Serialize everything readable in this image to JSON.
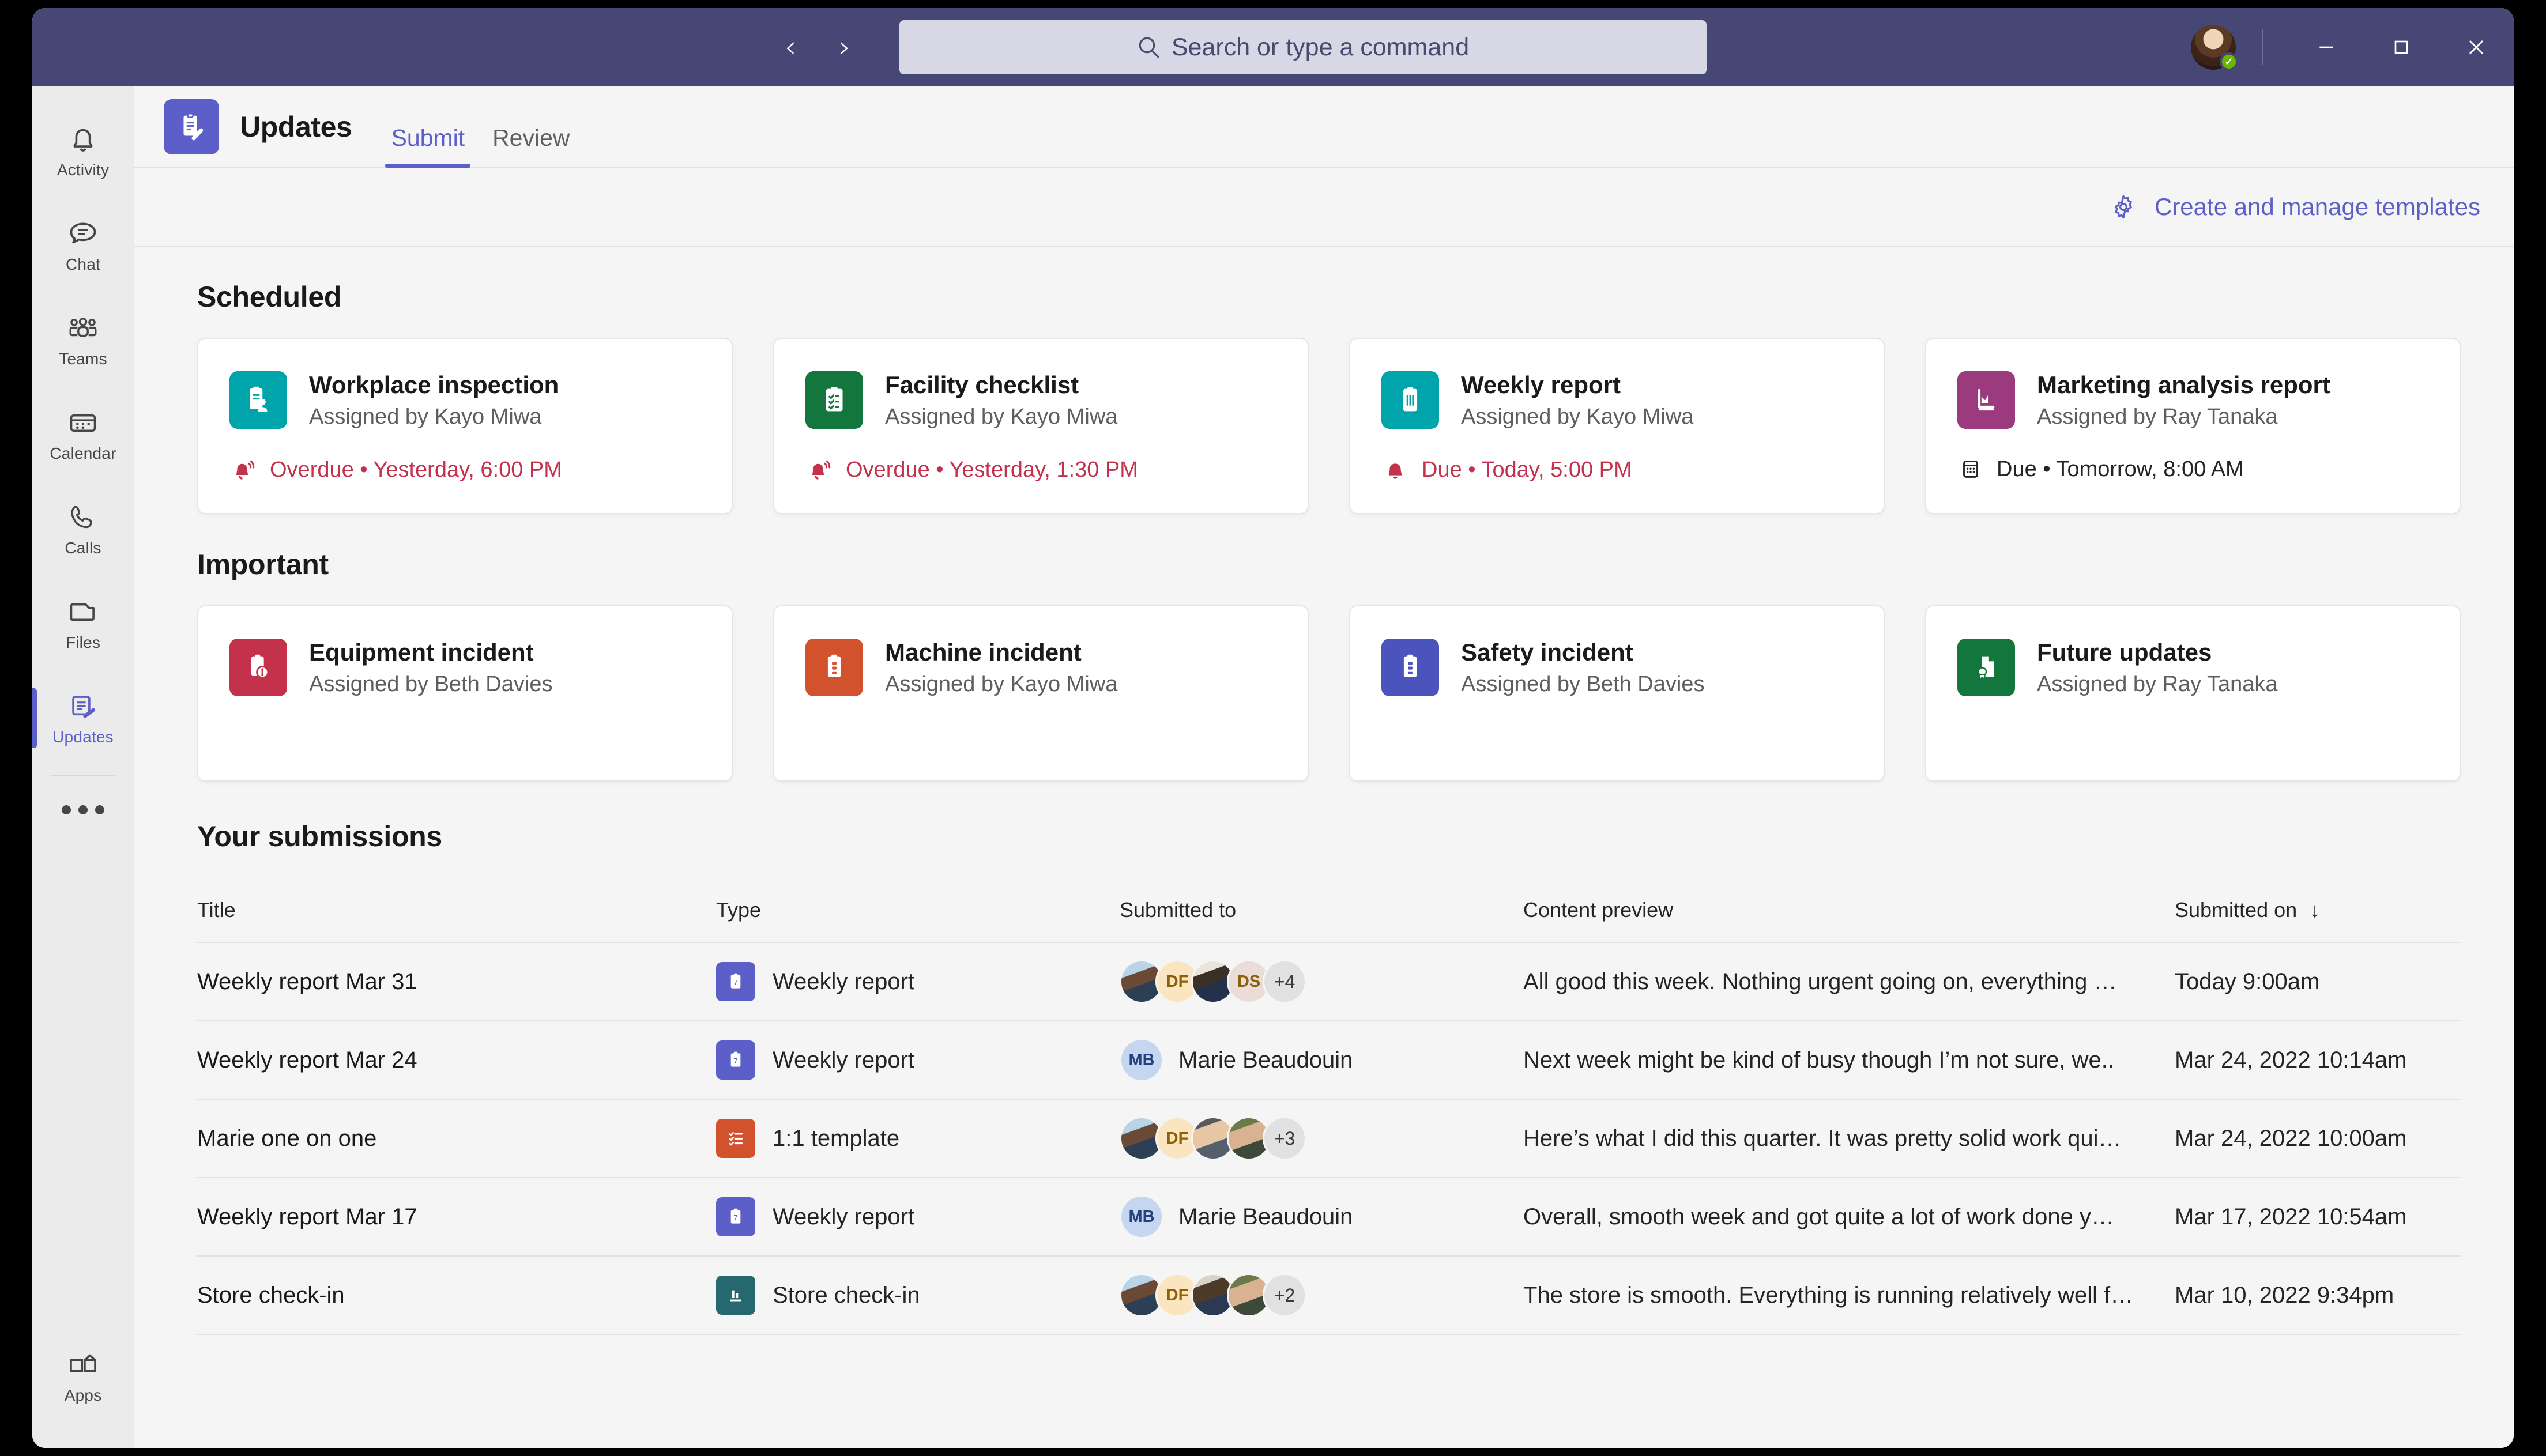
{
  "titlebar": {
    "back_label": "‹",
    "forward_label": "›",
    "search_placeholder": "Search or type a command",
    "minimize_label": "—",
    "maximize_label": "▢",
    "close_label": "✕"
  },
  "rail": {
    "items": [
      {
        "label": "Activity",
        "icon": "bell-icon"
      },
      {
        "label": "Chat",
        "icon": "chat-icon"
      },
      {
        "label": "Teams",
        "icon": "teams-icon"
      },
      {
        "label": "Calendar",
        "icon": "calendar-icon"
      },
      {
        "label": "Calls",
        "icon": "phone-icon"
      },
      {
        "label": "Files",
        "icon": "files-icon"
      },
      {
        "label": "Updates",
        "icon": "clipboard-pen-icon",
        "active": true
      }
    ],
    "more_label": "•••",
    "apps_label": "Apps"
  },
  "header": {
    "app_title": "Updates",
    "app_icon": "clipboard-pen-icon",
    "tabs": [
      {
        "label": "Submit",
        "active": true
      },
      {
        "label": "Review",
        "active": false
      }
    ]
  },
  "toolbar": {
    "templates_label": "Create and manage templates",
    "templates_icon": "gear-icon"
  },
  "sections": [
    {
      "title": "Scheduled",
      "cards": [
        {
          "name": "Workplace inspection",
          "assigned": "Assigned by Kayo Miwa",
          "badge_color": "#00a5ac",
          "badge_icon": "inspection-icon",
          "due_text": "Overdue • Yesterday, 6:00 PM",
          "due_state": "overdue",
          "due_icon": "bell-ring-icon"
        },
        {
          "name": "Facility checklist",
          "assigned": "Assigned by Kayo Miwa",
          "badge_color": "#13773d",
          "badge_icon": "checklist-icon",
          "due_text": "Overdue • Yesterday, 1:30 PM",
          "due_state": "overdue",
          "due_icon": "bell-ring-icon"
        },
        {
          "name": "Weekly report",
          "assigned": "Assigned by Kayo Miwa",
          "badge_color": "#00a5ac",
          "badge_icon": "report-icon",
          "due_text": "Due • Today, 5:00 PM",
          "due_state": "due",
          "due_icon": "bell-icon"
        },
        {
          "name": "Marketing analysis report",
          "assigned": "Assigned by Ray Tanaka",
          "badge_color": "#9b3b7e",
          "badge_icon": "chart-icon",
          "due_text": "Due • Tomorrow, 8:00 AM",
          "due_state": "normal",
          "due_icon": "calendar-icon"
        }
      ]
    },
    {
      "title": "Important",
      "cards": [
        {
          "name": "Equipment incident",
          "assigned": "Assigned by Beth Davies",
          "badge_color": "#c4314b",
          "badge_icon": "alert-clipboard-icon"
        },
        {
          "name": "Machine incident",
          "assigned": "Assigned by Kayo Miwa",
          "badge_color": "#d3522e",
          "badge_icon": "machine-clipboard-icon"
        },
        {
          "name": "Safety incident",
          "assigned": "Assigned by Beth Davies",
          "badge_color": "#4b53bc",
          "badge_icon": "safety-clipboard-icon"
        },
        {
          "name": "Future updates",
          "assigned": "Assigned by Ray Tanaka",
          "badge_color": "#13773d",
          "badge_icon": "certificate-icon"
        }
      ]
    }
  ],
  "submissions": {
    "title": "Your submissions",
    "columns": [
      "Title",
      "Type",
      "Submitted to",
      "Content preview",
      "Submitted on"
    ],
    "sort_indicator": "↓",
    "rows": [
      {
        "title": "Weekly report Mar 31",
        "type": "Weekly report",
        "type_color": "#5b5fc7",
        "type_icon": "weekly-report-icon",
        "submitted_to_mode": "group",
        "avatars": [
          {
            "kind": "photo",
            "style": "ph1"
          },
          {
            "kind": "initials",
            "text": "DF",
            "style": "av-initials-df"
          },
          {
            "kind": "photo",
            "style": "ph2"
          },
          {
            "kind": "initials",
            "text": "DS",
            "style": "av-initials-ds"
          }
        ],
        "overflow": "+4",
        "preview": "All good this week. Nothing urgent going on, everything …",
        "submitted_on": "Today 9:00am"
      },
      {
        "title": "Weekly report Mar 24",
        "type": "Weekly report",
        "type_color": "#5b5fc7",
        "type_icon": "weekly-report-icon",
        "submitted_to_mode": "named",
        "named_initials": "MB",
        "named_label": "Marie Beaudouin",
        "preview": "Next week might be kind of busy though I’m not sure, we..",
        "submitted_on": "Mar 24, 2022 10:14am"
      },
      {
        "title": "Marie one on one",
        "type": "1:1 template",
        "type_color": "#d3522e",
        "type_icon": "checklist-lines-icon",
        "submitted_to_mode": "group",
        "avatars": [
          {
            "kind": "photo",
            "style": "ph1"
          },
          {
            "kind": "initials",
            "text": "DF",
            "style": "av-initials-df"
          },
          {
            "kind": "photo",
            "style": "ph3"
          },
          {
            "kind": "photo",
            "style": "ph4"
          }
        ],
        "overflow": "+3",
        "preview": "Here’s what I did this quarter. It was pretty solid work qui…",
        "submitted_on": "Mar 24, 2022 10:00am"
      },
      {
        "title": "Weekly report Mar 17",
        "type": "Weekly report",
        "type_color": "#5b5fc7",
        "type_icon": "weekly-report-icon",
        "submitted_to_mode": "named",
        "named_initials": "MB",
        "named_label": "Marie Beaudouin",
        "preview": "Overall, smooth week and got quite a lot of work done y…",
        "submitted_on": "Mar 17, 2022 10:54am"
      },
      {
        "title": "Store check-in",
        "type": "Store check-in",
        "type_color": "#25686f",
        "type_icon": "store-chart-icon",
        "submitted_to_mode": "group",
        "avatars": [
          {
            "kind": "photo",
            "style": "ph1"
          },
          {
            "kind": "initials",
            "text": "DF",
            "style": "av-initials-df"
          },
          {
            "kind": "photo",
            "style": "ph5"
          },
          {
            "kind": "photo",
            "style": "ph4"
          }
        ],
        "overflow": "+2",
        "preview": "The store is smooth. Everything is running relatively well f…",
        "submitted_on": "Mar 10, 2022 9:34pm"
      }
    ]
  },
  "colors": {
    "brand": "#5b5fc7",
    "titlebar": "#464775",
    "danger": "#c4314b"
  }
}
